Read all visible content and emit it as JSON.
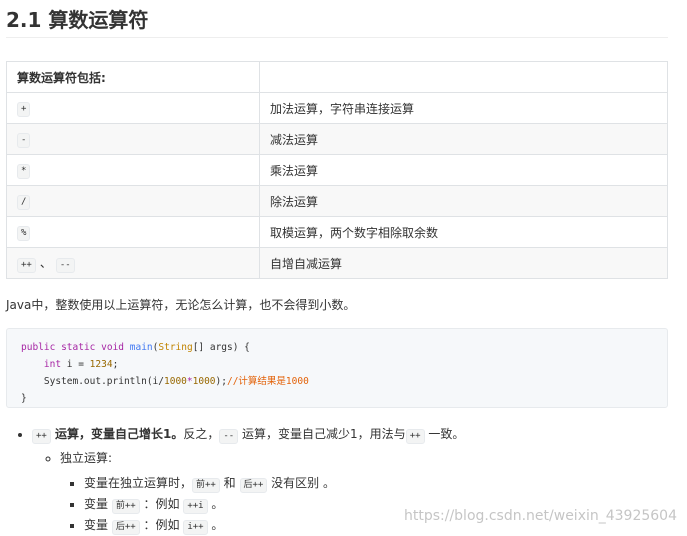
{
  "title": "2.1 算数运算符",
  "table": {
    "header": "算数运算符包括:",
    "rows": [
      {
        "op": "+",
        "desc": "加法运算，字符串连接运算"
      },
      {
        "op": "-",
        "desc": "减法运算"
      },
      {
        "op": "*",
        "desc": "乘法运算"
      },
      {
        "op": "/",
        "desc": "除法运算"
      },
      {
        "op": "%",
        "desc": "取模运算，两个数字相除取余数"
      }
    ],
    "last_row": {
      "op1": "++",
      "sep": "、",
      "op2": "--",
      "desc": "自增自减运算"
    }
  },
  "paragraph": "Java中，整数使用以上运算符，无论怎么计算，也不会得到小数。",
  "code": {
    "kw_public": "public",
    "kw_static": "static",
    "kw_void": "void",
    "method": "main",
    "paren_open": "(",
    "type_string": "String",
    "args_rest": "[] args) {",
    "kw_int": "int",
    "var_decl": " i = ",
    "num_1234": "1234",
    "semi": ";",
    "println_start": "System.out.println(i/",
    "num_1000a": "1000",
    "times": "*",
    "num_1000b": "1000",
    "println_end": ");",
    "comment": "//计算结果是1000",
    "close_brace": "}"
  },
  "bullets": {
    "main": {
      "code_pp": "++",
      "text_bold": " 运算，变量自己增长1。",
      "text_1": "反之，",
      "code_mm": "--",
      "text_2": " 运算，变量自己减少1，用法与",
      "code_pp2": "++",
      "text_3": " 一致。"
    },
    "sub": {
      "label": "独立运算:",
      "items": [
        {
          "pre": "变量在独立运算时，",
          "c1": "前++",
          "mid": " 和 ",
          "c2": "后++",
          "post": " 没有区别 。"
        },
        {
          "pre": "变量 ",
          "c1": "前++",
          "mid": " ：例如 ",
          "c2": "++i",
          "post": " 。"
        },
        {
          "pre": "变量 ",
          "c1": "后++",
          "mid": " ：例如 ",
          "c2": "i++",
          "post": " 。"
        }
      ]
    }
  },
  "watermark": "https://blog.csdn.net/weixin_43925604"
}
